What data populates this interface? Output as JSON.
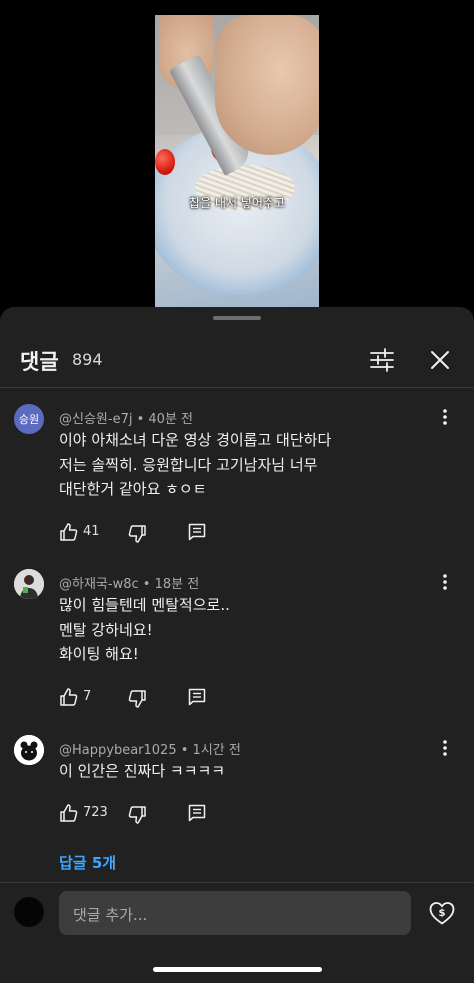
{
  "video": {
    "caption": "찹을 내서 넣어주고"
  },
  "sheet": {
    "title": "댓글",
    "count": "894",
    "filter_icon": "sliders-icon",
    "close_icon": "close-icon"
  },
  "comments": [
    {
      "avatar_text": "승원",
      "avatar_color": "#5c6bc0",
      "author": "@신승원-e7j",
      "time": "40분 전",
      "lines": [
        "이야 아채소녀 다운 영상 경이롭고 대단하다",
        "저는 솔찍히. 응원합니다 고기남자님 너무",
        "대단한거 같아요 ㅎㅇㅌ"
      ],
      "likes": "41"
    },
    {
      "avatar_text": "",
      "avatar_color": "#e8e8e8",
      "author": "@하재국-w8c",
      "time": "18분 전",
      "lines": [
        "많이 힘들텐데 멘탈적으로..",
        "멘탈 강하네요!",
        "화이팅 해요!"
      ],
      "likes": "7"
    },
    {
      "avatar_text": "",
      "avatar_color": "#ffffff",
      "author": "@Happybear1025",
      "time": "1시간 전",
      "lines": [
        "이 인간은 진짜다 ㅋㅋㅋㅋ"
      ],
      "likes": "723"
    }
  ],
  "replies_link": "답글 5개",
  "input": {
    "placeholder": "댓글 추가..."
  }
}
